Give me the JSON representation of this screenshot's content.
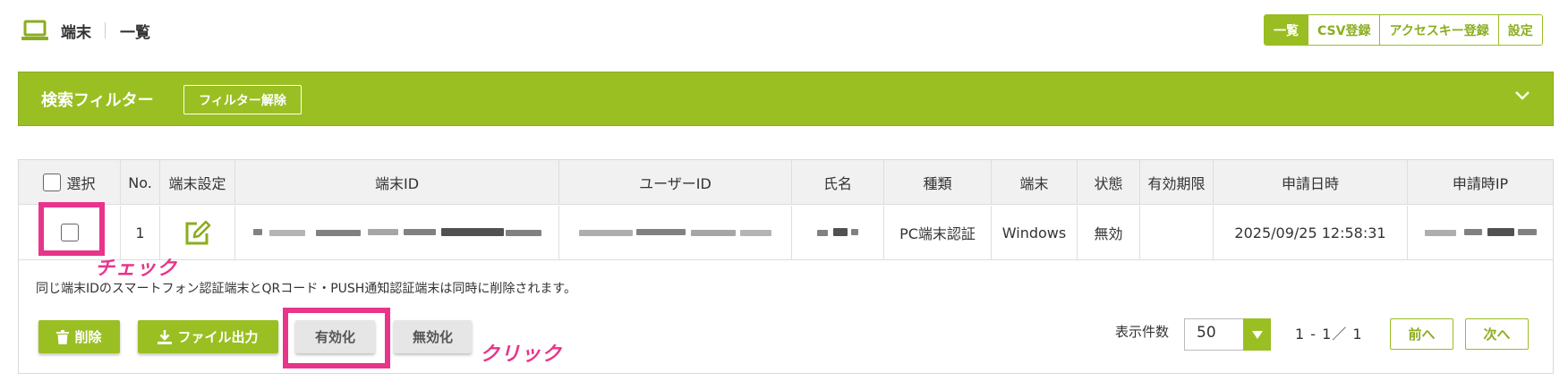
{
  "header": {
    "icon": "laptop-icon",
    "title": "端末",
    "subtitle": "一覧",
    "tabs": [
      {
        "label": "一覧",
        "active": true
      },
      {
        "label": "CSV登録",
        "active": false
      },
      {
        "label": "アクセスキー登録",
        "active": false
      },
      {
        "label": "設定",
        "active": false
      }
    ]
  },
  "filter": {
    "title": "検索フィルター",
    "clear_label": "フィルター解除",
    "toggle_icon": "chevron-down-icon"
  },
  "table": {
    "columns": [
      "選択",
      "No.",
      "端末設定",
      "端末ID",
      "ユーザーID",
      "氏名",
      "種類",
      "端末",
      "状態",
      "有効期限",
      "申請日時",
      "申請時IP"
    ],
    "rows": [
      {
        "checked": false,
        "no": "1",
        "settings_icon": "edit-icon",
        "device_id": "",
        "user_id": "",
        "name": "",
        "type": "PC端末認証",
        "device": "Windows",
        "status": "無効",
        "expiry": "",
        "applied_at": "2025/09/25 12:58:31",
        "applied_ip": ""
      }
    ]
  },
  "note": "同じ端末IDのスマートフォン認証端末とQRコード・PUSH通知認証端末は同時に削除されます。",
  "actions": {
    "delete": "削除",
    "export": "ファイル出力",
    "enable": "有効化",
    "disable": "無効化"
  },
  "annotations": {
    "check": "チェック",
    "click": "クリック",
    "highlight_color": "#e8348b"
  },
  "pagination": {
    "per_page_label": "表示件数",
    "per_page_value": "50",
    "range": "1 - 1／ 1",
    "prev": "前へ",
    "next": "次へ"
  },
  "colors": {
    "accent": "#9abf22",
    "highlight": "#e8348b"
  }
}
